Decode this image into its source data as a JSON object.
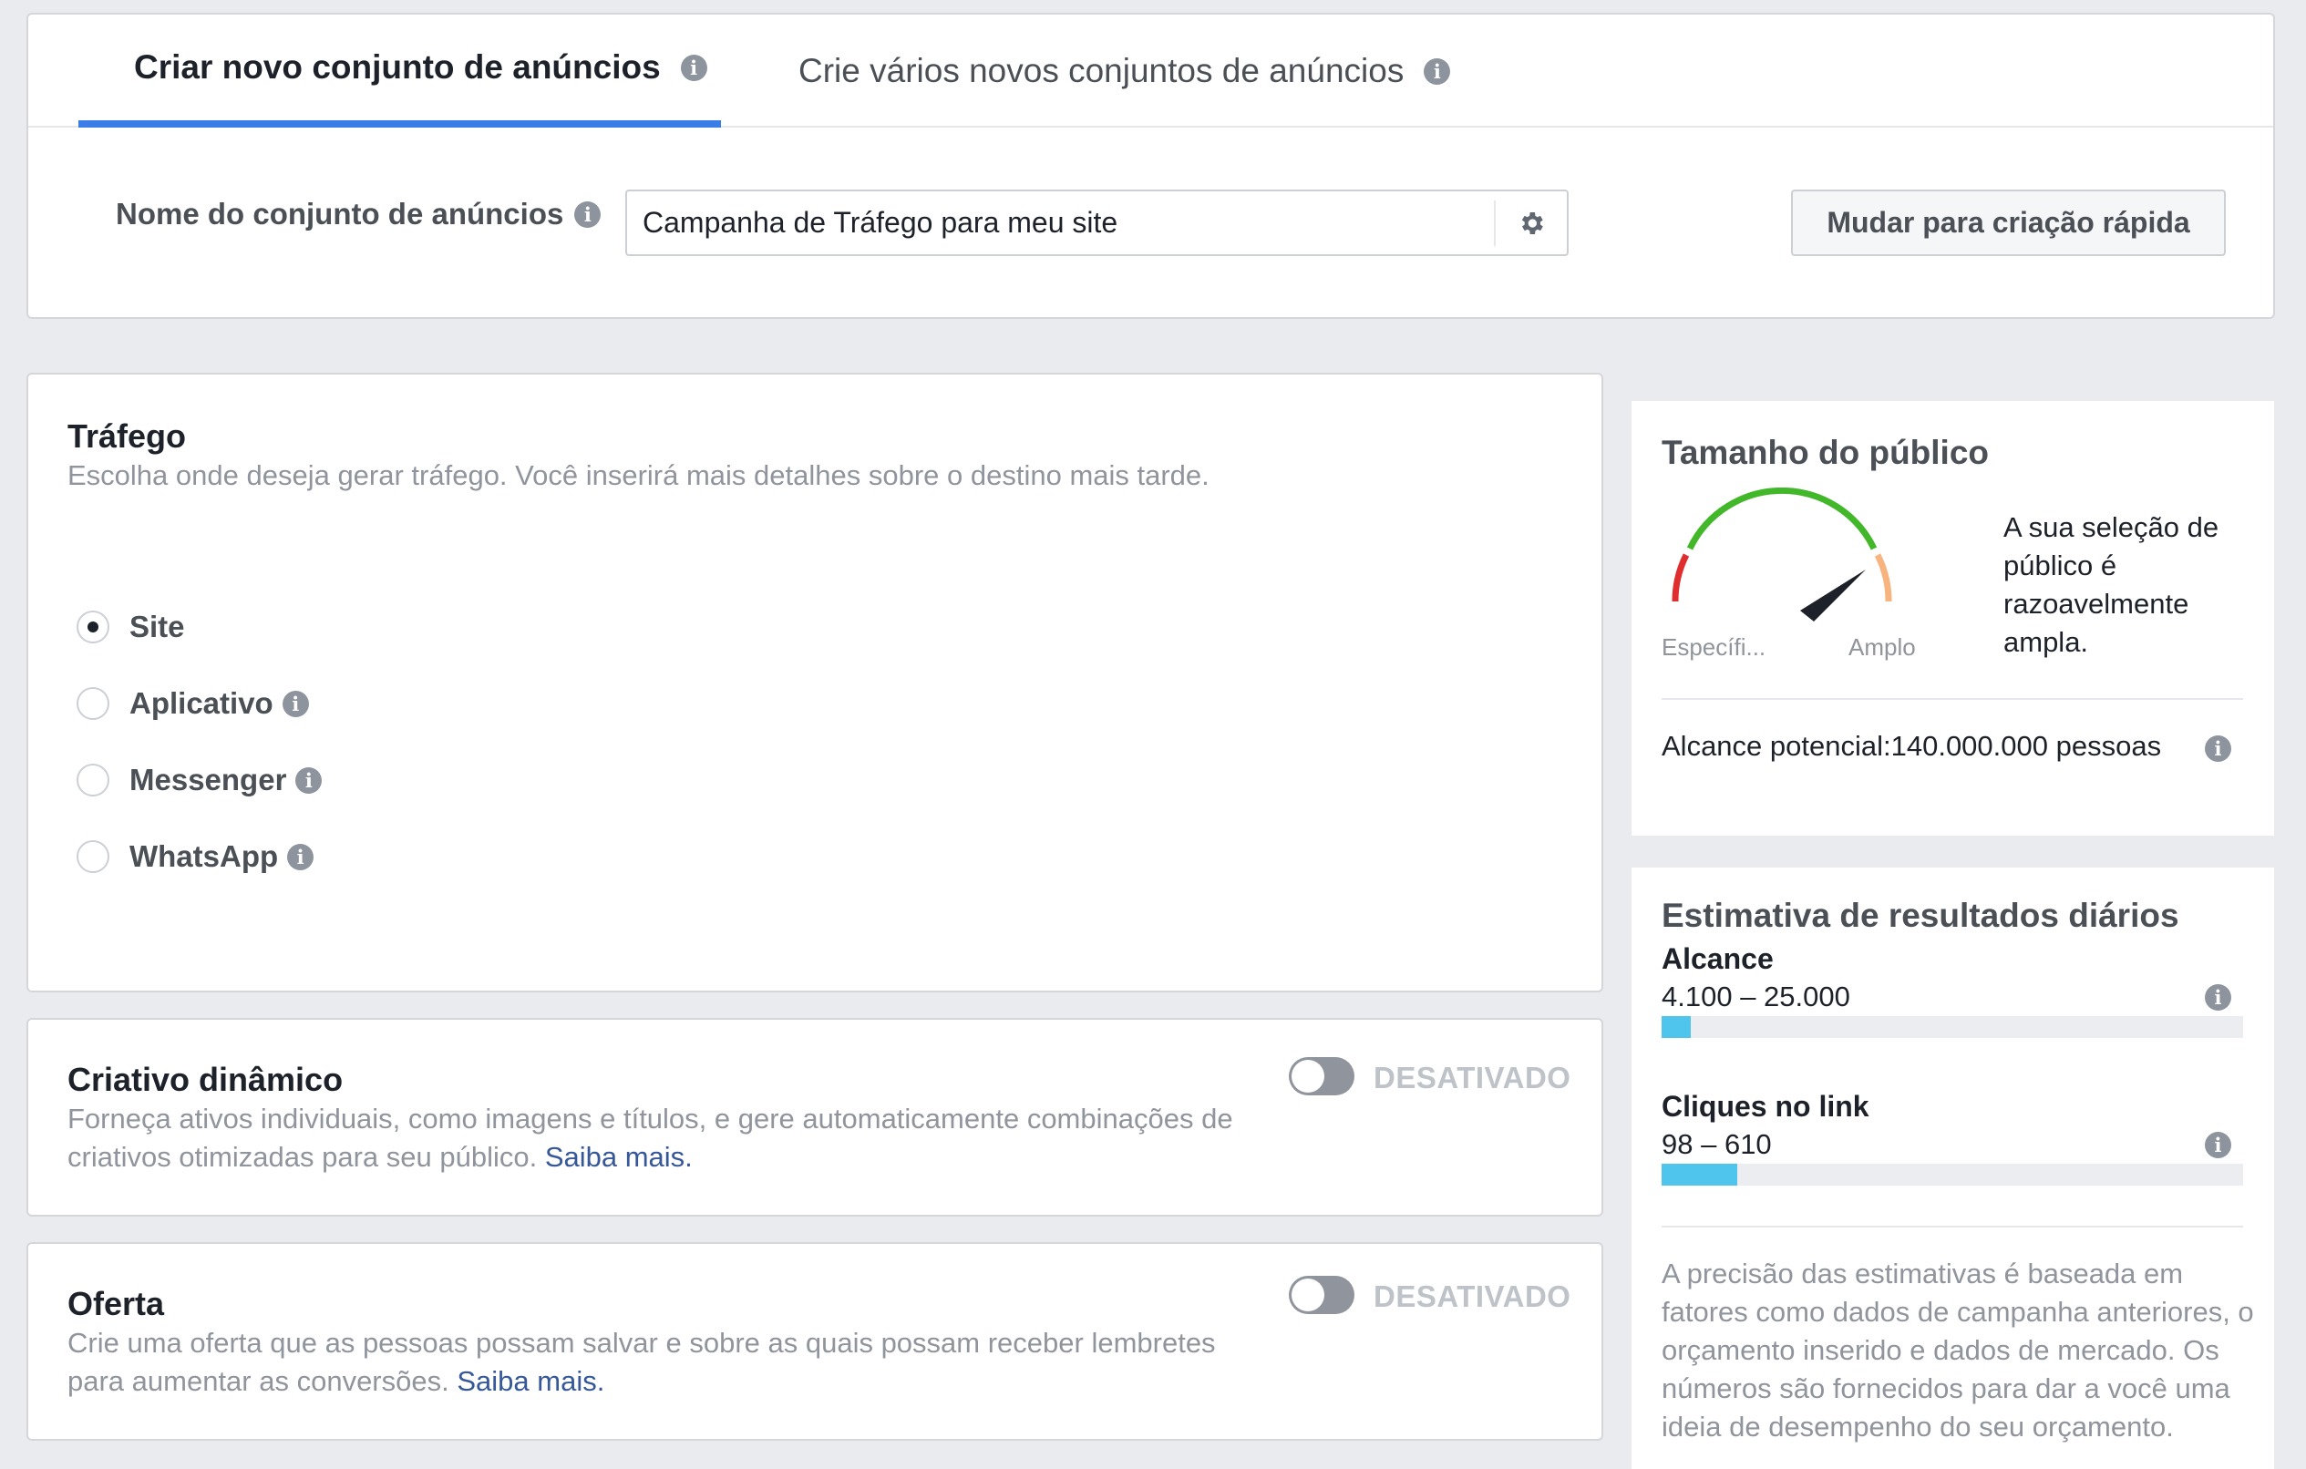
{
  "tabs": {
    "active": "Criar novo conjunto de anúncios",
    "inactive": "Crie vários novos conjuntos de anúncios"
  },
  "ad_set_name": {
    "label": "Nome do conjunto de anúncios",
    "value": "Campanha de Tráfego para meu site",
    "settings_icon": "gear-icon"
  },
  "quick_create_button": "Mudar para criação rápida",
  "traffic": {
    "title": "Tráfego",
    "description": "Escolha onde deseja gerar tráfego. Você inserirá mais detalhes sobre o destino mais tarde.",
    "options": [
      {
        "label": "Site",
        "checked": true
      },
      {
        "label": "Aplicativo",
        "checked": false
      },
      {
        "label": "Messenger",
        "checked": false
      },
      {
        "label": "WhatsApp",
        "checked": false
      }
    ]
  },
  "dynamic_creative": {
    "title": "Criativo dinâmico",
    "description": "Forneça ativos individuais, como imagens e títulos, e gere automaticamente combinações de criativos otimizadas para seu público.",
    "link": "Saiba mais.",
    "toggle_state": "DESATIVADO"
  },
  "offer": {
    "title": "Oferta",
    "description": "Crie uma oferta que as pessoas possam salvar e sobre as quais possam receber lembretes para aumentar as conversões.",
    "link": "Saiba mais.",
    "toggle_state": "DESATIVADO"
  },
  "audience_size": {
    "title": "Tamanho do público",
    "gauge_left": "Específi...",
    "gauge_right": "Amplo",
    "gauge_level": 0.78,
    "summary": "A sua seleção de público é razoavelmente ampla.",
    "reach_label": "Alcance potencial:140.000.000 pessoas"
  },
  "daily_results": {
    "title": "Estimativa de resultados diários",
    "metrics": [
      {
        "label": "Alcance",
        "value": "4.100 – 25.000",
        "fill": 0.05
      },
      {
        "label": "Cliques no link",
        "value": "98 – 610",
        "fill": 0.13
      }
    ],
    "disclaimer": "A precisão das estimativas é baseada em fatores como dados de campanha anteriores, o orçamento inserido e dados de mercado. Os números são fornecidos para dar a você uma ideia de desempenho do seu orçamento."
  },
  "colors": {
    "accent": "#3b7de6",
    "link": "#365899",
    "bar_fill": "#4fc4ed",
    "gauge_green": "#42b72a",
    "gauge_red": "#e02e2e",
    "gauge_orange": "#f7b47e"
  }
}
